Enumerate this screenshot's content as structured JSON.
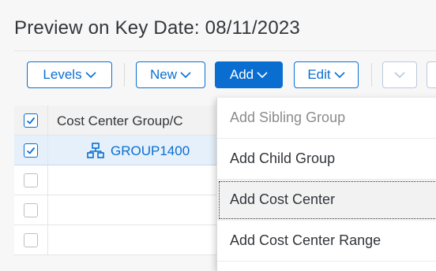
{
  "page": {
    "title": "Preview on Key Date: 08/11/2023"
  },
  "toolbar": {
    "levels_label": "Levels",
    "new_label": "New",
    "add_label": "Add",
    "edit_label": "Edit"
  },
  "table": {
    "header": {
      "column_label": "Cost Center Group/C",
      "checked": true
    },
    "rows": [
      {
        "label": "GROUP1400",
        "checked": true,
        "selected": true,
        "icon": "hierarchy-icon"
      },
      {
        "label": "",
        "checked": false
      },
      {
        "label": "",
        "checked": false
      },
      {
        "label": "",
        "checked": false
      }
    ]
  },
  "add_menu": {
    "items": [
      {
        "label": "Add Sibling Group",
        "state": "disabled"
      },
      {
        "label": "Add Child Group",
        "state": "enabled"
      },
      {
        "label": "Add Cost Center",
        "state": "focused"
      },
      {
        "label": "Add Cost Center Range",
        "state": "enabled"
      }
    ]
  },
  "colors": {
    "accent": "#0a6ed1",
    "selected_row": "#e5f0fa"
  }
}
